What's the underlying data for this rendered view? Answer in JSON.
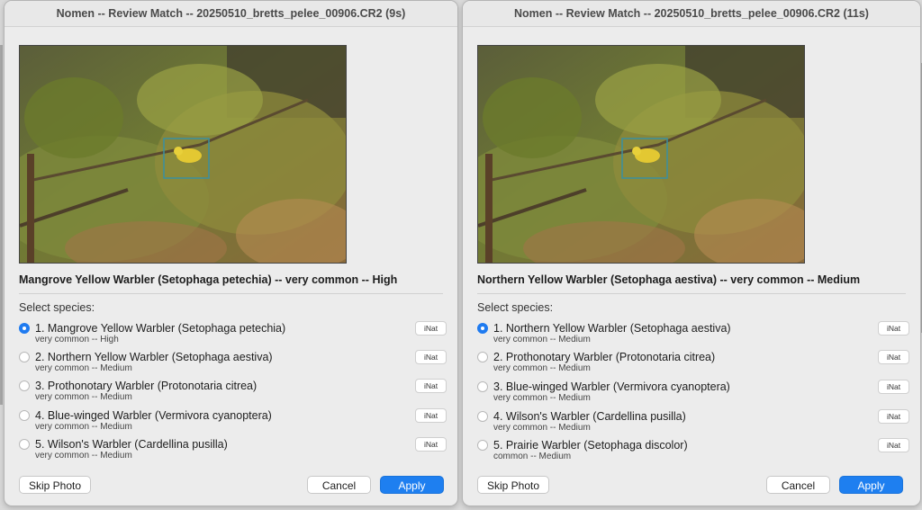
{
  "left_window": {
    "title": "Nomen -- Review Match -- 20250510_bretts_pelee_00906.CR2 (9s)",
    "match_line": "Mangrove Yellow Warbler (Setophaga petechia) -- very common -- High",
    "select_label": "Select species:",
    "options": [
      {
        "label": "1. Mangrove Yellow Warbler (Setophaga petechia)",
        "sub": "very common -- High",
        "selected": true,
        "inat": "iNat"
      },
      {
        "label": "2. Northern Yellow Warbler (Setophaga aestiva)",
        "sub": "very common -- Medium",
        "selected": false,
        "inat": "iNat"
      },
      {
        "label": "3. Prothonotary Warbler (Protonotaria citrea)",
        "sub": "very common -- Medium",
        "selected": false,
        "inat": "iNat"
      },
      {
        "label": "4. Blue-winged Warbler (Vermivora cyanoptera)",
        "sub": "very common -- Medium",
        "selected": false,
        "inat": "iNat"
      },
      {
        "label": "5. Wilson's Warbler (Cardellina pusilla)",
        "sub": "very common -- Medium",
        "selected": false,
        "inat": "iNat"
      }
    ],
    "skip_label": "Skip Photo",
    "cancel_label": "Cancel",
    "apply_label": "Apply"
  },
  "right_window": {
    "title": "Nomen -- Review Match -- 20250510_bretts_pelee_00906.CR2 (11s)",
    "match_line": "Northern Yellow Warbler (Setophaga aestiva) -- very common -- Medium",
    "select_label": "Select species:",
    "options": [
      {
        "label": "1. Northern Yellow Warbler (Setophaga aestiva)",
        "sub": "very common -- Medium",
        "selected": true,
        "inat": "iNat"
      },
      {
        "label": "2. Prothonotary Warbler (Protonotaria citrea)",
        "sub": "very common -- Medium",
        "selected": false,
        "inat": "iNat"
      },
      {
        "label": "3. Blue-winged Warbler (Vermivora cyanoptera)",
        "sub": "very common -- Medium",
        "selected": false,
        "inat": "iNat"
      },
      {
        "label": "4. Wilson's Warbler (Cardellina pusilla)",
        "sub": "very common -- Medium",
        "selected": false,
        "inat": "iNat"
      },
      {
        "label": "5. Prairie Warbler (Setophaga discolor)",
        "sub": "common -- Medium",
        "selected": false,
        "inat": "iNat"
      }
    ],
    "skip_label": "Skip Photo",
    "cancel_label": "Cancel",
    "apply_label": "Apply"
  },
  "colors": {
    "accent": "#1e7ff0",
    "window_bg": "#ececec",
    "bird": "#e3c832",
    "detection_box": "#3a8fa0"
  },
  "icons": [
    "radio-selected",
    "radio-unselected"
  ]
}
